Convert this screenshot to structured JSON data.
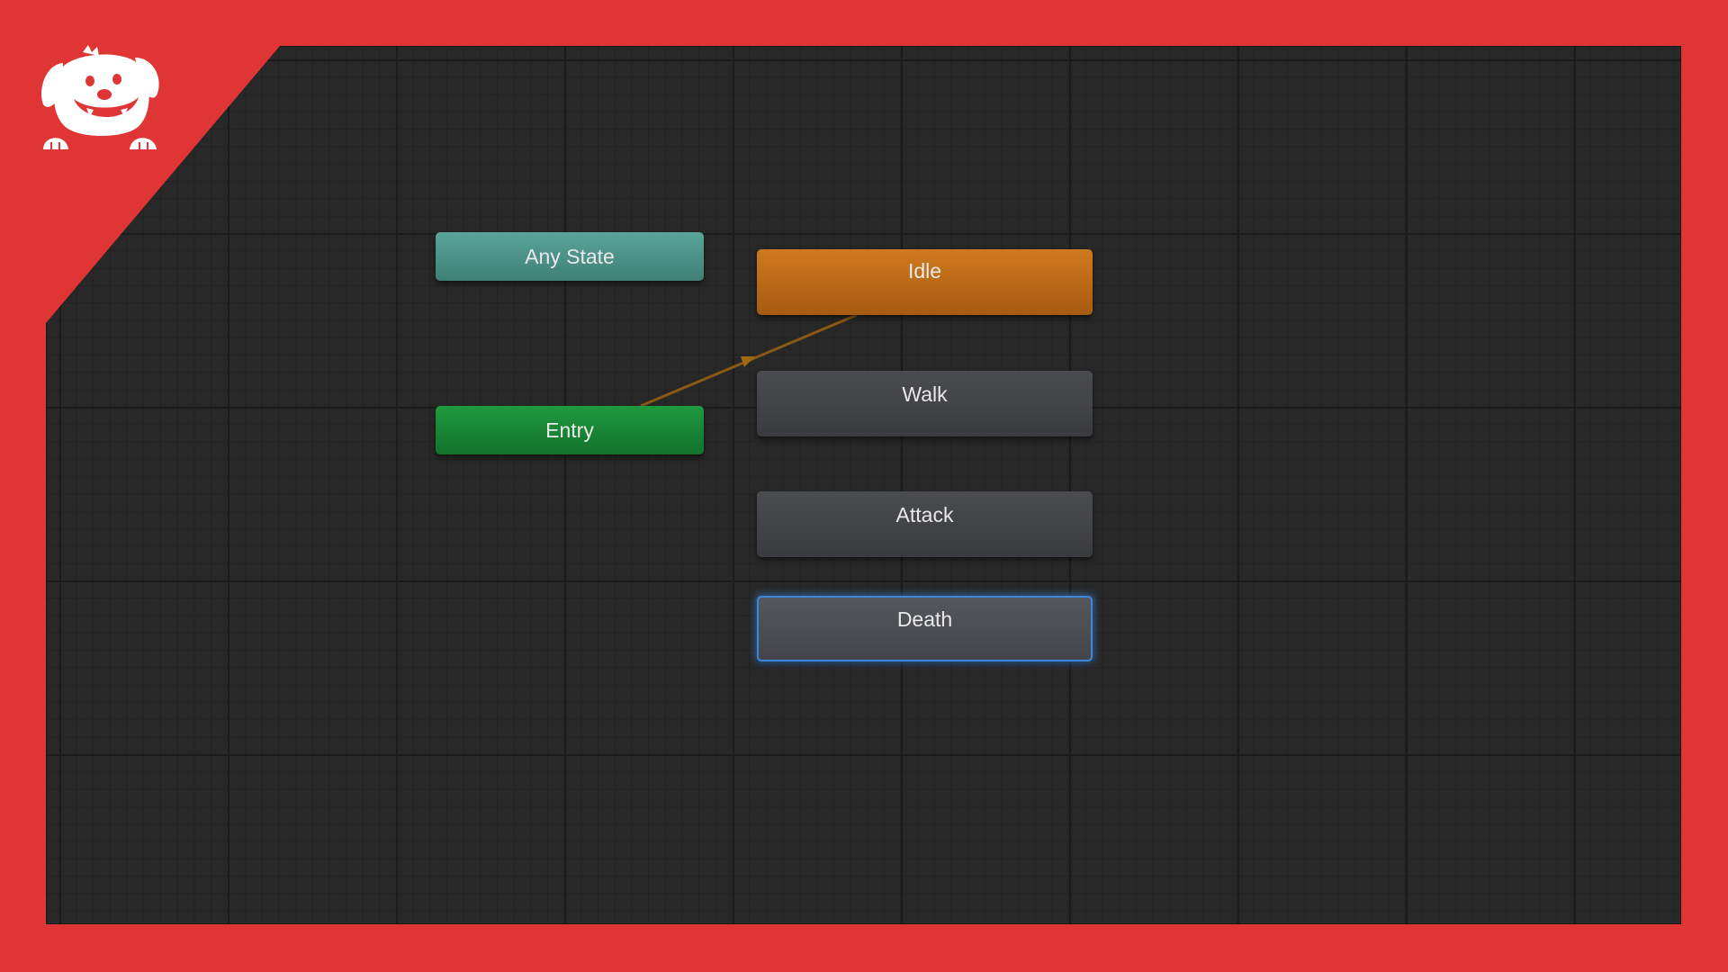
{
  "states": {
    "any_state": {
      "label": "Any State",
      "color": "#4f9289"
    },
    "entry": {
      "label": "Entry",
      "color": "#188534"
    },
    "idle": {
      "label": "Idle",
      "color": "#bb6a18"
    },
    "walk": {
      "label": "Walk",
      "color": "#424347"
    },
    "attack": {
      "label": "Attack",
      "color": "#424347"
    },
    "death": {
      "label": "Death",
      "color": "#4b4d52",
      "selected": true
    }
  },
  "transitions": [
    {
      "from": "Entry",
      "to": "Idle",
      "color": "#8a5a12"
    }
  ],
  "theme": {
    "frame": "#e03535",
    "canvas": "#282828",
    "selection": "#3f86d8"
  },
  "logo": {
    "icon": "dog-mascot-icon"
  }
}
